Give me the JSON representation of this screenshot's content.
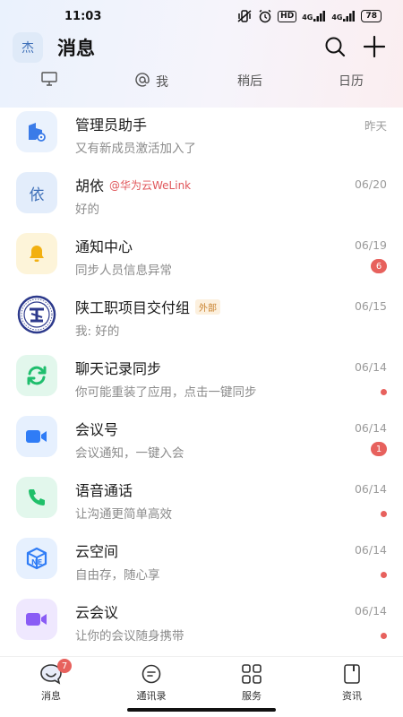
{
  "status": {
    "time": "11:03",
    "hd": "HD",
    "net1": "4G",
    "net2": "4G",
    "battery": "78"
  },
  "header": {
    "avatar_text": "杰",
    "title": "消息"
  },
  "tabs": [
    {
      "label": "",
      "icon": "monitor-icon"
    },
    {
      "label": "我",
      "icon": "at-icon"
    },
    {
      "label": "稍后"
    },
    {
      "label": "日历"
    }
  ],
  "conversations": [
    {
      "name": "管理员助手",
      "sub": "又有新成员激活加入了",
      "date": "昨天",
      "icon": "admin-assistant-icon",
      "color": "#3a7be8"
    },
    {
      "name": "胡依",
      "mention": "@华为云WeLink",
      "sub": "好的",
      "date": "06/20",
      "avatar_text": "依"
    },
    {
      "name": "通知中心",
      "sub": "同步人员信息异常",
      "date": "06/19",
      "badge": "6",
      "icon": "bell-icon",
      "color": "#f2b011"
    },
    {
      "name": "陕工职项目交付组",
      "tag": "外部",
      "sub": "我: 好的",
      "date": "06/15",
      "icon": "school-seal-icon",
      "color": "#2d3a8c"
    },
    {
      "name": "聊天记录同步",
      "sub": "你可能重装了应用，点击一键同步",
      "date": "06/14",
      "dot": true,
      "icon": "sync-icon",
      "color": "#1fbe6d"
    },
    {
      "name": "会议号",
      "sub": "会议通知，一键入会",
      "date": "06/14",
      "badge": "1",
      "icon": "video-icon",
      "color": "#2f7cf6"
    },
    {
      "name": "语音通话",
      "sub": "让沟通更简单高效",
      "date": "06/14",
      "dot": true,
      "icon": "phone-icon",
      "color": "#20c06a"
    },
    {
      "name": "云空间",
      "sub": "自由存，随心享",
      "date": "06/14",
      "dot": true,
      "icon": "cloud-space-icon",
      "color": "#2f7cf6"
    },
    {
      "name": "云会议",
      "sub": "让你的会议随身携带",
      "date": "06/14",
      "dot": true,
      "icon": "cloud-meeting-icon",
      "color": "#8a5cf5"
    }
  ],
  "nav": [
    {
      "label": "消息",
      "badge": "7",
      "icon": "chat-icon"
    },
    {
      "label": "通讯录",
      "icon": "contacts-icon"
    },
    {
      "label": "服务",
      "icon": "grid-icon"
    },
    {
      "label": "资讯",
      "icon": "news-icon"
    }
  ]
}
